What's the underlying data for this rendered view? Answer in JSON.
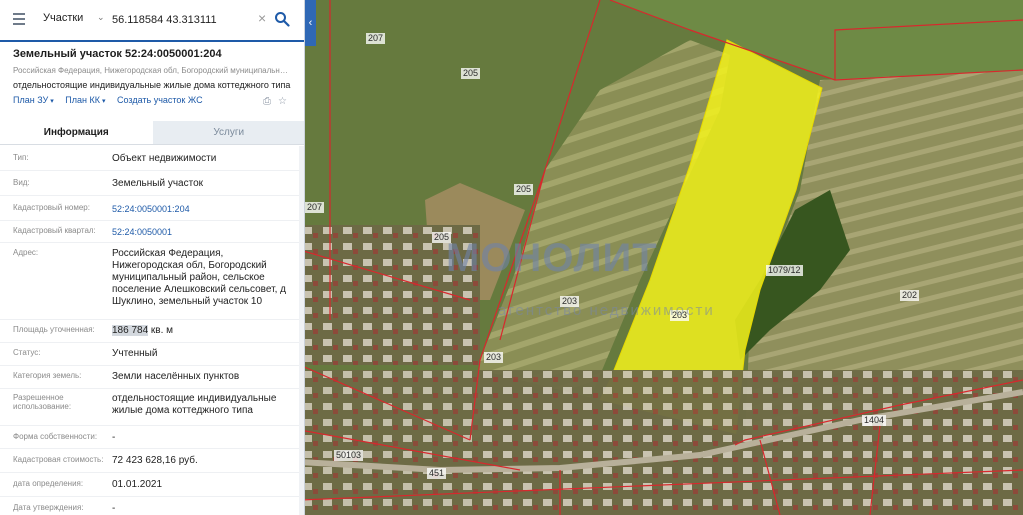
{
  "search": {
    "layer": "Участки",
    "query": "56.118584 43.313111"
  },
  "object": {
    "title": "Земельный участок 52:24:0050001:204",
    "address_short": "Российская Федерация, Нижегородская обл, Богородский муниципальный район, сельское поселение Алешковский сельсовет, д Шуклино, земельный...",
    "use_short": "отдельностоящие индивидуальные жилые дома коттеджного типа",
    "links": [
      "План ЗУ",
      "План КК",
      "Создать участок ЖС"
    ]
  },
  "tabs": [
    "Информация",
    "Услуги"
  ],
  "fields": [
    {
      "label": "Тип:",
      "value": "Объект недвижимости"
    },
    {
      "label": "Вид:",
      "value": "Земельный участок"
    },
    {
      "label": "Кадастровый номер:",
      "value": "52:24:0050001:204"
    },
    {
      "label": "Кадастровый квартал:",
      "value": "52:24:0050001"
    },
    {
      "label": "Адрес:",
      "value": "Российская Федерация, Нижегородская обл, Богородский муниципальный район, сельское поселение Алешковский сельсовет, д Шуклино, земельный участок 10"
    },
    {
      "label": "Площадь уточненная:",
      "value_num": "186 784",
      "value_unit": " кв. м"
    },
    {
      "label": "Статус:",
      "value": "Учтенный"
    },
    {
      "label": "Категория земель:",
      "value": "Земли населённых пунктов"
    },
    {
      "label": "Разрешенное использование:",
      "value": "отдельностоящие индивидуальные жилые дома коттеджного типа"
    },
    {
      "label": "Форма собственности:",
      "value": "-"
    },
    {
      "label": "Кадастровая стоимость:",
      "value": "72 423 628,16 руб."
    },
    {
      "label": "дата определения:",
      "value": "01.01.2021"
    },
    {
      "label": "Дата утверждения:",
      "value": "-"
    }
  ],
  "map": {
    "labels": [
      "207",
      "205",
      "205",
      "205",
      "207",
      "203",
      "203",
      "203",
      "202",
      "1079/12",
      "1404",
      "451",
      "50103"
    ],
    "watermark": "МОНОЛИТ",
    "watermark_sub": "агентство недвижимости",
    "highlight_color": "#f3f21c"
  }
}
